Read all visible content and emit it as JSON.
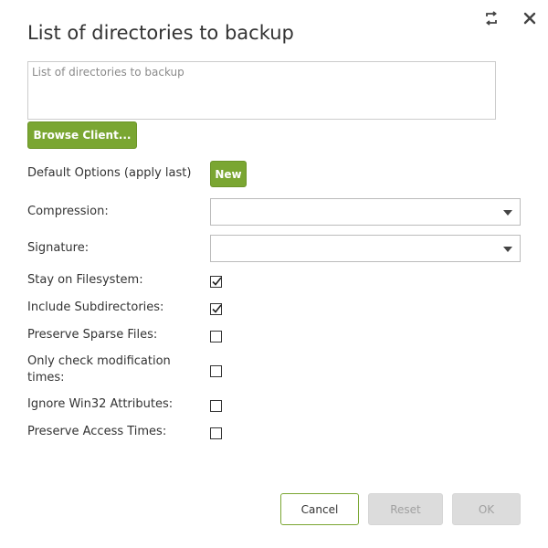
{
  "dialog": {
    "title": "List of directories to backup",
    "icons": {
      "restore": "restore-icon",
      "close": "close-icon"
    }
  },
  "directories": {
    "placeholder": "List of directories to backup",
    "value": ""
  },
  "browse_button": "Browse Client...",
  "default_options": {
    "label": "Default Options (apply last)",
    "new_button": "New"
  },
  "fields": {
    "compression": {
      "label": "Compression:",
      "value": ""
    },
    "signature": {
      "label": "Signature:",
      "value": ""
    }
  },
  "checkboxes": [
    {
      "label": "Stay on Filesystem:",
      "checked": true
    },
    {
      "label": "Include Subdirectories:",
      "checked": true
    },
    {
      "label": "Preserve Sparse Files:",
      "checked": false
    },
    {
      "label": "Only check modification times:",
      "checked": false
    },
    {
      "label": "Ignore Win32 Attributes:",
      "checked": false
    },
    {
      "label": "Preserve Access Times:",
      "checked": false
    }
  ],
  "footer": {
    "cancel": "Cancel",
    "reset": "Reset",
    "ok": "OK"
  },
  "colors": {
    "accent": "#7aa632",
    "disabled_bg": "#dcdcdc",
    "disabled_text": "#a0a0a0"
  }
}
